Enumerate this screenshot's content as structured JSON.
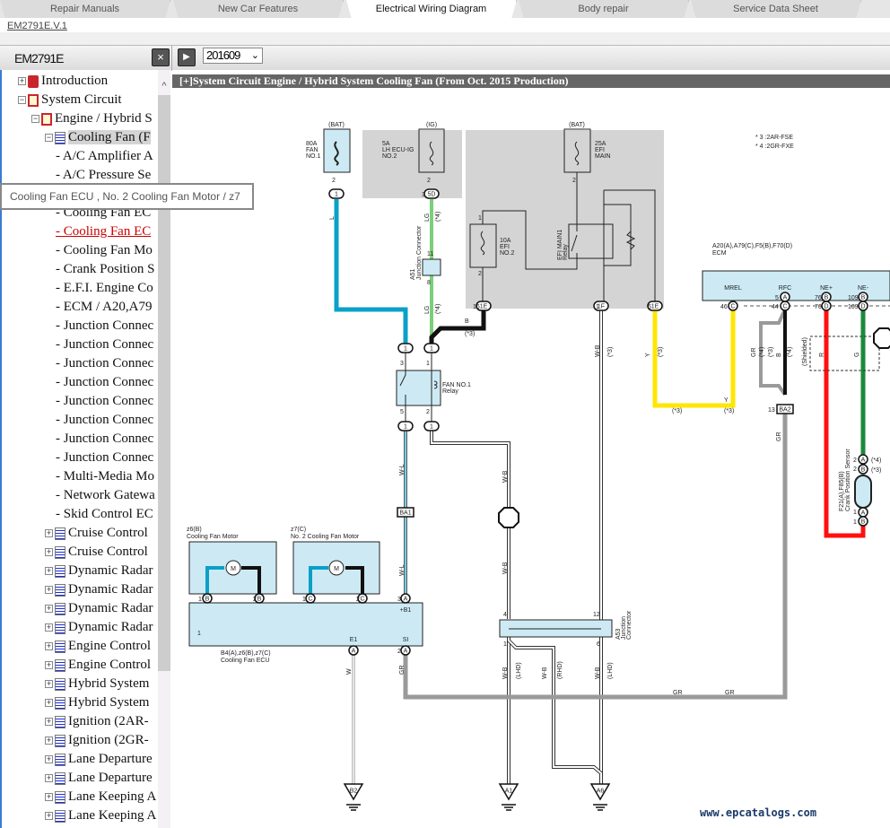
{
  "tabs": [
    "Repair Manuals",
    "New Car Features",
    "Electrical Wiring Diagram",
    "Body repair",
    "Service Data Sheet"
  ],
  "active_tab": "Electrical Wiring Diagram",
  "doc_link": "EM2791E.V.1",
  "toolbar": {
    "doc_id": "EM2791E",
    "close": "×",
    "play": "▶",
    "version": "201609",
    "chevron": "⌄"
  },
  "sidebar": {
    "top": [
      {
        "label": "Introduction",
        "toggle": "+"
      },
      {
        "label": "System Circuit",
        "toggle": "−"
      },
      {
        "label": "Engine / Hybrid S",
        "toggle": "−"
      },
      {
        "label": "Cooling Fan (F",
        "toggle": "−"
      }
    ],
    "children": [
      "- A/C Amplifier A",
      "- A/C Pressure Se",
      "- Cooling Fan EC",
      "- Cooling Fan EC",
      "- Cooling Fan Mo",
      "- Crank Position S",
      "- E.F.I. Engine Co",
      "- ECM / A20,A79",
      "- Junction Connec",
      "- Junction Connec",
      "- Junction Connec",
      "- Junction Connec",
      "- Junction Connec",
      "- Junction Connec",
      "- Junction Connec",
      "- Junction Connec",
      "- Multi-Media Mo",
      "- Network Gatewa",
      "- Skid Control EC"
    ],
    "siblings": [
      "Cruise Control",
      "Cruise Control",
      "Dynamic Radar",
      "Dynamic Radar",
      "Dynamic Radar",
      "Dynamic Radar",
      "Engine Control",
      "Engine Control",
      "Hybrid System",
      "Hybrid System",
      "Ignition (2AR-",
      "Ignition (2GR-",
      "Lane Departure",
      "Lane Departure",
      "Lane Keeping A",
      "Lane Keeping A"
    ],
    "scroll_up": "^"
  },
  "tooltip": "Cooling Fan ECU , No. 2 Cooling Fan Motor / z7",
  "diagram": {
    "title": "[+]System Circuit  Engine / Hybrid System  Cooling Fan (From Oct. 2015 Production)",
    "footnotes": [
      "* 3 :2AR-FSE",
      "* 4 :2GR-FXE"
    ],
    "fuses": {
      "fan": [
        "(BAT)",
        "80A",
        "FAN",
        "NO.1"
      ],
      "lhecu": [
        "(IG)",
        "5A",
        "LH ECU-IG",
        "NO.2"
      ],
      "efimain": [
        "(BAT)",
        "25A",
        "EFI",
        "MAIN"
      ],
      "efi2": [
        "10A",
        "EFI",
        "NO.2"
      ]
    },
    "components": {
      "a51": [
        "A51",
        "Junction Connector"
      ],
      "efi_relay": [
        "EFI MAIN1",
        "Relay"
      ],
      "fan_relay": [
        "FAN NO.1",
        "Relay"
      ],
      "ecm": [
        "A20(A),A79(C),F5(B),F70(D)",
        "ECM"
      ],
      "ecm_pins": [
        "MREL",
        "RFC",
        "NE+",
        "NE-"
      ],
      "motor1": [
        "z6(B)",
        "Cooling Fan Motor"
      ],
      "motor2": [
        "z7(C)",
        "No. 2 Cooling Fan Motor"
      ],
      "ecu": [
        "B4(A),z6(B),z7(C)",
        "Cooling Fan ECU"
      ],
      "ecu_pins": [
        "+B1",
        "E1",
        "SI"
      ],
      "a53": [
        "A53",
        "Junction",
        "Connector"
      ],
      "crank": [
        "F21(A),F85(B)",
        "Crank Position Sensor"
      ],
      "shielded": "(Shielded)",
      "motor": "M"
    },
    "connectors": [
      "1",
      "5D",
      "1E",
      "1F",
      "1E",
      "1",
      "1",
      "1",
      "1",
      "BA1",
      "BA2",
      "B",
      "B",
      "C",
      "C",
      "A",
      "A",
      "A",
      "C",
      "C",
      "A",
      "B",
      "B",
      "D",
      "D",
      "A",
      "B",
      "A",
      "B",
      "B2",
      "A1",
      "A6"
    ],
    "pins": [
      "2",
      "2",
      "3",
      "2",
      "1",
      "2",
      "11",
      "8",
      "16",
      "1",
      "6",
      "3",
      "1",
      "5",
      "2",
      "1",
      "2",
      "1",
      "2",
      "1",
      "3",
      "2",
      "4",
      "12",
      "1",
      "6",
      "46",
      "5",
      "44",
      "76",
      "76",
      "109",
      "109",
      "13",
      "2",
      "2",
      "1",
      "1"
    ],
    "wire_colors": [
      "L",
      "LG",
      "LG",
      "B",
      "W-L",
      "W-L",
      "W-B",
      "W-B",
      "W-B",
      "W-B",
      "W-B",
      "W",
      "GR",
      "GR",
      "GR",
      "Y",
      "Y",
      "GR",
      "B",
      "R",
      "G",
      "GR",
      "W-B",
      "(RHD)",
      "(LHD)",
      "(LHD)"
    ],
    "notes": [
      "(*4)",
      "(*4)",
      "(*3)",
      "(*3)",
      "(*3)",
      "(*3)",
      "(*3)",
      "(*4)",
      "(*4)",
      "(*3)",
      "(*4)",
      "(*3)"
    ],
    "wire_hex": {
      "L": "#0aa0c8",
      "LG": "#7ccf7a",
      "B": "#111111",
      "Y": "#ffe600",
      "GR": "#9a9a9a",
      "R": "#ff1010",
      "G": "#1a8a3a",
      "box": "#cdeaf4",
      "gray": "#d4d4d4"
    }
  },
  "watermark": "www.epcatalogs.com"
}
